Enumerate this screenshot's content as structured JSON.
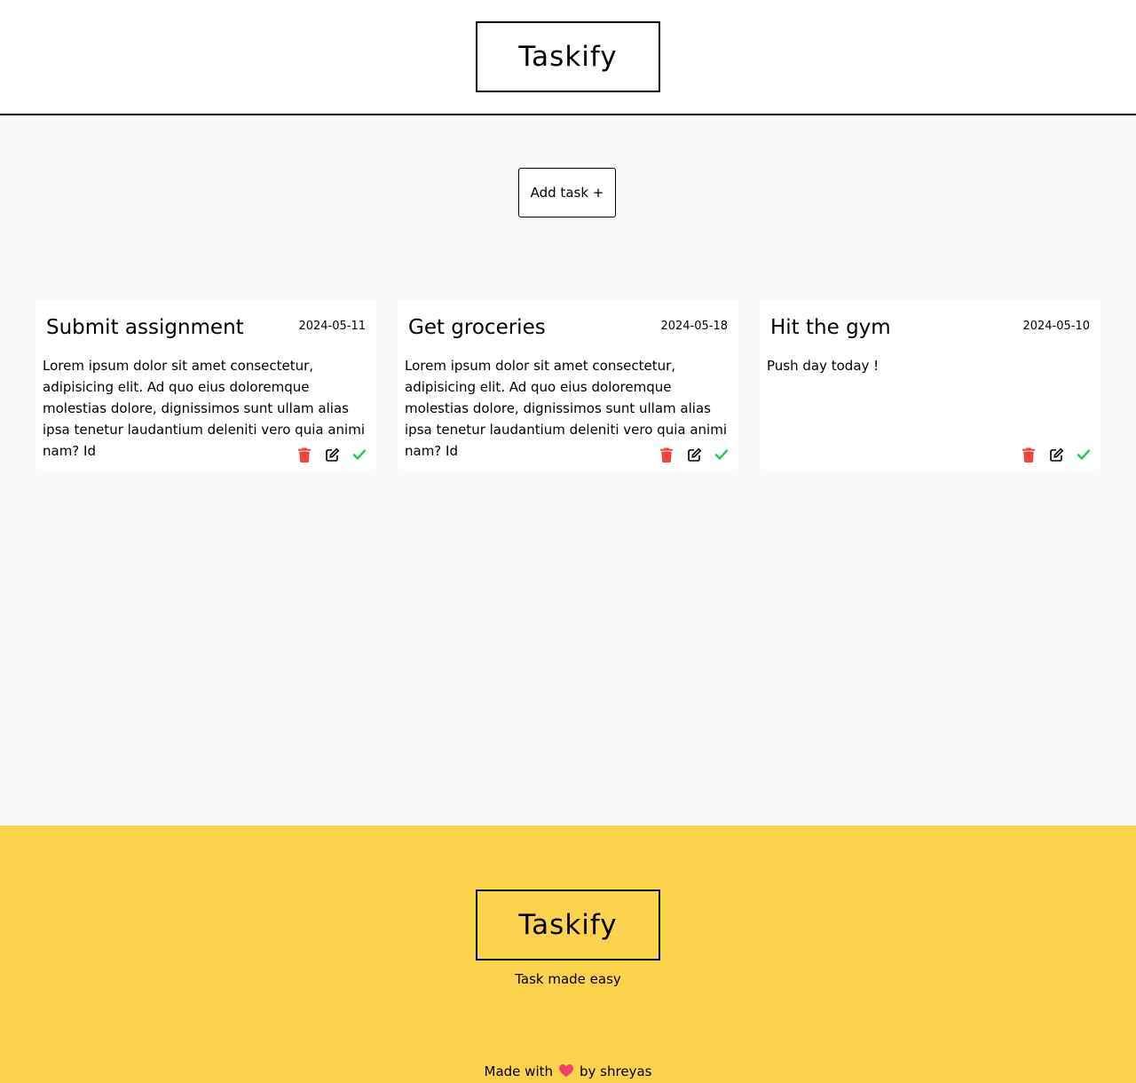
{
  "header": {
    "logo": "Taskify"
  },
  "main": {
    "add_button_label": "Add task +"
  },
  "tasks": [
    {
      "title": "Submit assignment",
      "date": "2024-05-11",
      "description": "Lorem ipsum dolor sit amet consectetur, adipisicing elit. Ad quo eius doloremque molestias dolore, dignissimos sunt ullam alias ipsa tenetur laudantium deleniti vero quia animi nam? Id"
    },
    {
      "title": "Get groceries",
      "date": "2024-05-18",
      "description": "Lorem ipsum dolor sit amet consectetur, adipisicing elit. Ad quo eius doloremque molestias dolore, dignissimos sunt ullam alias ipsa tenetur laudantium deleniti vero quia animi nam? Id"
    },
    {
      "title": "Hit the gym",
      "date": "2024-05-10",
      "description": "Push day today !"
    }
  ],
  "icons": {
    "delete": "trash-icon",
    "edit": "edit-icon",
    "complete": "check-icon",
    "heart": "heart-icon"
  },
  "colors": {
    "delete": "#ef4444",
    "complete": "#22c55e",
    "footer_bg": "#fcd34d",
    "page_bg": "#f8f9fa"
  },
  "footer": {
    "logo": "Taskify",
    "tagline": "Task made easy",
    "made_with_prefix": "Made with",
    "made_with_suffix": "by shreyas"
  }
}
